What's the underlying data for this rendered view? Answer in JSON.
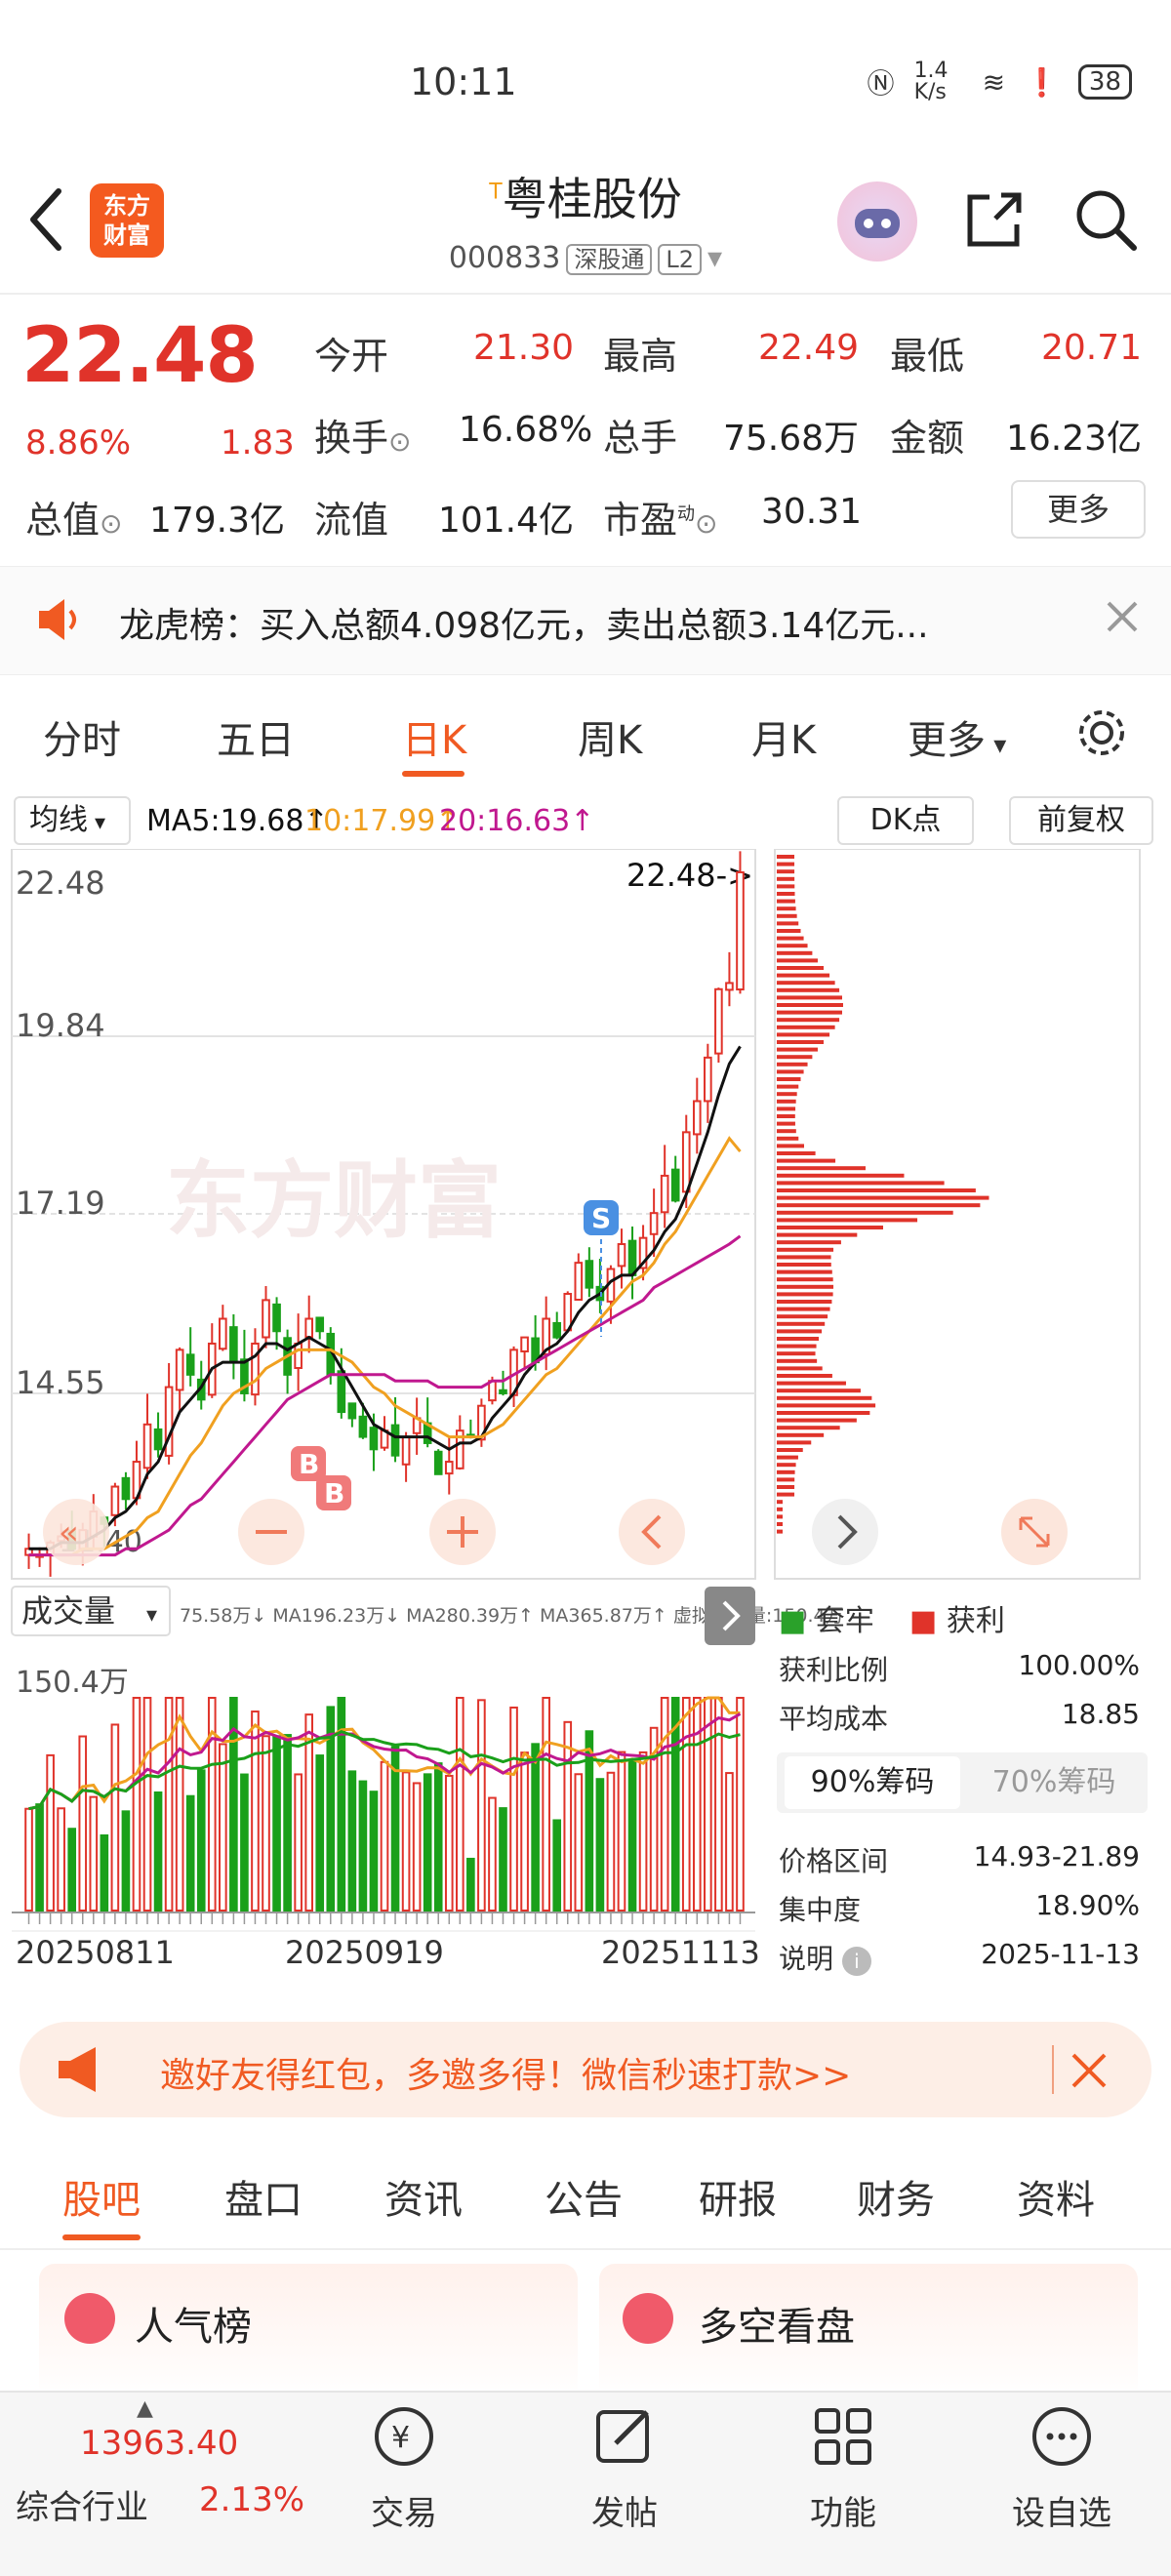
{
  "status_bar": {
    "time": "10:11",
    "network_speed": "1.4 K/s",
    "battery": "38"
  },
  "header": {
    "stock_name": "粤桂股份",
    "stock_marker": "T",
    "stock_code": "000833",
    "tag_connect": "深股通",
    "tag_level": "L2",
    "logo_text_line1": "东方",
    "logo_text_line2": "财富"
  },
  "quote": {
    "price": "22.48",
    "change_pct": "8.86%",
    "change": "1.83",
    "rows": [
      [
        {
          "label": "今开",
          "value": "21.30",
          "red": true
        },
        {
          "label": "最高",
          "value": "22.49",
          "red": true
        },
        {
          "label": "最低",
          "value": "20.71",
          "red": true
        }
      ],
      [
        {
          "label": "换手",
          "value": "16.68%",
          "red": false
        },
        {
          "label": "总手",
          "value": "75.68万",
          "red": false
        },
        {
          "label": "金额",
          "value": "16.23亿",
          "red": false
        }
      ],
      [
        {
          "label": "总值",
          "value": "179.3亿",
          "red": false
        },
        {
          "label": "流值",
          "value": "101.4亿",
          "red": false
        },
        {
          "label": "市盈",
          "value": "30.31",
          "red": false
        }
      ]
    ],
    "pe_superscript": "动",
    "more_label": "更多"
  },
  "announcement": {
    "text": "龙虎榜：买入总额4.098亿元，卖出总额3.14亿元..."
  },
  "chart_tabs": [
    "分时",
    "五日",
    "日K",
    "周K",
    "月K",
    "更多"
  ],
  "ma_bar": {
    "dropdown": "均线",
    "ma5": "MA5:19.68↑",
    "ma10": "10:17.99↑",
    "ma20": "20:16.63↑",
    "dk_label": "DK点",
    "fq_label": "前复权",
    "colors": {
      "ma5": "#111111",
      "ma10": "#f0a020",
      "ma20": "#c0188f"
    }
  },
  "kline": {
    "y_labels": [
      "22.48",
      "19.84",
      "17.19",
      "14.55"
    ],
    "low_label": "11.40",
    "last_price_label": "22.48->",
    "signals": [
      "S",
      "B",
      "B"
    ],
    "watermark": "东方财富"
  },
  "volume": {
    "dropdown": "成交量",
    "legend": "75.58万↓ MA196.23万↓ MA280.39万↑ MA365.87万↑ 虚拟成交量:150.4万",
    "max_label": "150.4万",
    "dates": [
      "20250811",
      "20250919",
      "20251113"
    ]
  },
  "chip": {
    "legend_trapped": "套牢",
    "legend_profit": "获利",
    "rows_top": [
      {
        "label": "获利比例",
        "value": "100.00%"
      },
      {
        "label": "平均成本",
        "value": "18.85"
      }
    ],
    "tab_90": "90%筹码",
    "tab_70": "70%筹码",
    "rows_bottom": [
      {
        "label": "价格区间",
        "value": "14.93-21.89"
      },
      {
        "label": "集中度",
        "value": "18.90%"
      },
      {
        "label": "说明",
        "value": "2025-11-13"
      }
    ]
  },
  "promo": {
    "text": "邀好友得红包，多邀多得！微信秒速打款>>"
  },
  "section_tabs": [
    "股吧",
    "盘口",
    "资讯",
    "公告",
    "研报",
    "财务",
    "资料"
  ],
  "cards": {
    "left_title": "人气榜",
    "right_title": "多空看盘"
  },
  "bottom_nav": {
    "index_value": "13963.40",
    "sector": "综合行业",
    "sector_pct": "2.13%",
    "items": [
      "交易",
      "发帖",
      "功能",
      "设自选"
    ]
  },
  "chart_data": {
    "type": "candlestick",
    "title": "",
    "xlabel": "",
    "ylabel": "",
    "ylim": [
      11.4,
      22.48
    ],
    "x_ticks": [
      "20250811",
      "20250919",
      "20251113"
    ],
    "close": [
      11.6,
      11.5,
      11.7,
      11.8,
      11.6,
      11.9,
      12.2,
      12.0,
      12.6,
      12.4,
      13.0,
      13.6,
      13.2,
      14.2,
      14.8,
      14.4,
      14.0,
      14.9,
      15.3,
      14.6,
      14.1,
      14.9,
      15.6,
      15.1,
      14.4,
      14.9,
      15.3,
      15.1,
      14.4,
      13.8,
      13.7,
      13.4,
      13.2,
      13.5,
      13.1,
      13.4,
      13.7,
      13.3,
      12.8,
      13.0,
      13.5,
      13.4,
      13.9,
      14.3,
      14.1,
      14.8,
      15.0,
      14.6,
      15.3,
      15.0,
      15.7,
      16.2,
      15.8,
      15.6,
      16.1,
      16.5,
      16.0,
      16.6,
      17.0,
      17.6,
      17.2,
      18.3,
      18.8,
      19.5,
      20.6,
      20.7,
      22.48
    ],
    "series": [
      {
        "name": "MA5",
        "values": [
          11.6,
          11.6,
          11.6,
          11.7,
          11.7,
          11.7,
          11.8,
          11.9,
          12.1,
          12.2,
          12.4,
          12.8,
          13.0,
          13.4,
          13.8,
          14.0,
          14.2,
          14.5,
          14.6,
          14.6,
          14.6,
          14.7,
          14.9,
          14.9,
          14.8,
          14.9,
          15.0,
          14.9,
          14.8,
          14.5,
          14.2,
          13.9,
          13.6,
          13.5,
          13.4,
          13.4,
          13.4,
          13.4,
          13.3,
          13.2,
          13.3,
          13.3,
          13.4,
          13.7,
          13.9,
          14.1,
          14.4,
          14.6,
          14.8,
          14.9,
          15.1,
          15.4,
          15.6,
          15.7,
          15.9,
          16.0,
          16.0,
          16.2,
          16.4,
          16.7,
          16.9,
          17.3,
          17.8,
          18.3,
          18.9,
          19.4,
          19.68
        ]
      },
      {
        "name": "MA10",
        "values": [
          11.5,
          11.5,
          11.5,
          11.5,
          11.5,
          11.6,
          11.6,
          11.6,
          11.7,
          11.8,
          11.9,
          12.1,
          12.2,
          12.5,
          12.8,
          13.1,
          13.3,
          13.6,
          13.9,
          14.1,
          14.2,
          14.3,
          14.5,
          14.6,
          14.7,
          14.8,
          14.8,
          14.8,
          14.8,
          14.7,
          14.6,
          14.4,
          14.2,
          14.1,
          13.9,
          13.8,
          13.7,
          13.6,
          13.5,
          13.4,
          13.4,
          13.4,
          13.4,
          13.5,
          13.6,
          13.8,
          14.0,
          14.2,
          14.4,
          14.5,
          14.7,
          14.9,
          15.1,
          15.3,
          15.5,
          15.7,
          15.9,
          16.0,
          16.2,
          16.5,
          16.7,
          17.0,
          17.3,
          17.6,
          17.9,
          18.2,
          17.99
        ]
      },
      {
        "name": "MA20",
        "values": [
          11.5,
          11.5,
          11.5,
          11.5,
          11.5,
          11.5,
          11.5,
          11.5,
          11.5,
          11.6,
          11.6,
          11.7,
          11.8,
          11.9,
          12.1,
          12.3,
          12.4,
          12.6,
          12.8,
          13.0,
          13.2,
          13.4,
          13.6,
          13.8,
          14.0,
          14.1,
          14.2,
          14.3,
          14.4,
          14.4,
          14.4,
          14.4,
          14.4,
          14.4,
          14.3,
          14.3,
          14.3,
          14.3,
          14.2,
          14.2,
          14.2,
          14.2,
          14.2,
          14.3,
          14.3,
          14.4,
          14.5,
          14.6,
          14.7,
          14.8,
          14.9,
          15.0,
          15.1,
          15.2,
          15.3,
          15.4,
          15.5,
          15.6,
          15.8,
          15.9,
          16.0,
          16.1,
          16.2,
          16.3,
          16.4,
          16.5,
          16.63
        ]
      }
    ]
  }
}
